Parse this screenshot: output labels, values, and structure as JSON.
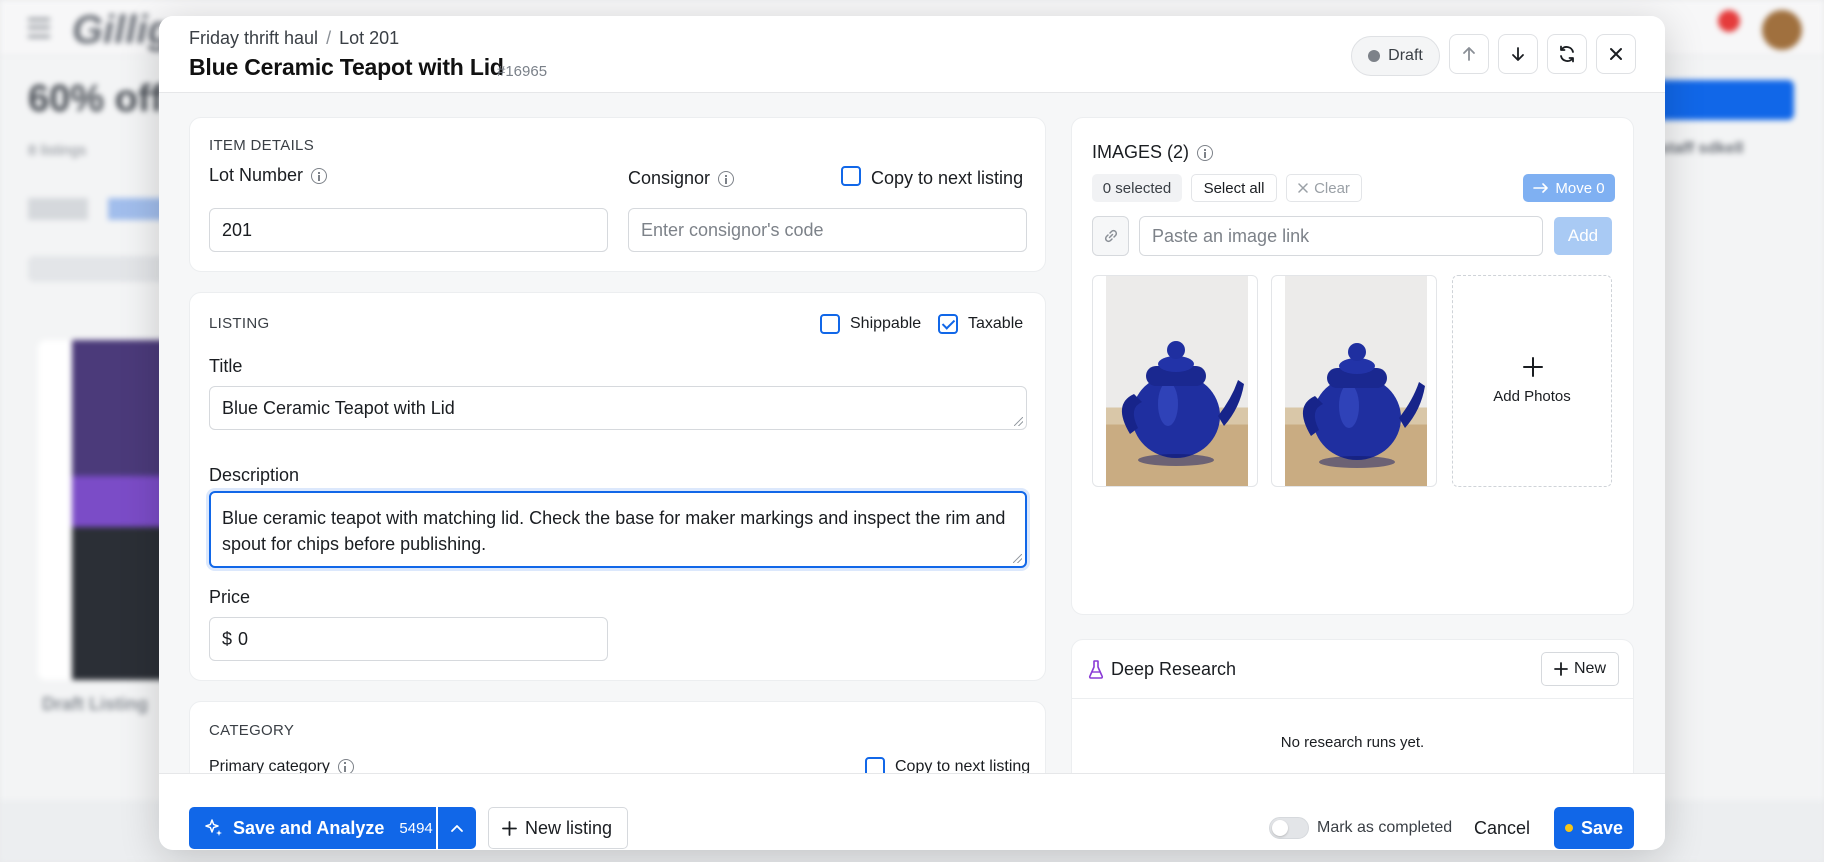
{
  "background": {
    "logo": "Gillig",
    "heading": "60% off",
    "subheading": "8 listings",
    "card_label": "Draft Listing",
    "right_user": "staff sdkell"
  },
  "modal": {
    "breadcrumb": {
      "parent": "Friday thrift haul",
      "separator": "/",
      "current": "Lot 201"
    },
    "title": "Blue Ceramic Teapot with Lid",
    "listing_id": "#16965",
    "status": "Draft",
    "colors": {
      "accent": "#1167e8",
      "status_dot": "#7d8289",
      "save_dot": "#f5c518"
    }
  },
  "item_details": {
    "section_label": "ITEM DETAILS",
    "lot_number_label": "Lot Number",
    "lot_number_value": "201",
    "consignor_label": "Consignor",
    "consignor_placeholder": "Enter consignor's code",
    "copy_label": "Copy to next listing",
    "copy_checked": false
  },
  "listing": {
    "section_label": "LISTING",
    "shippable_label": "Shippable",
    "shippable_checked": false,
    "taxable_label": "Taxable",
    "taxable_checked": true,
    "title_label": "Title",
    "title_value": "Blue Ceramic Teapot with Lid",
    "description_label": "Description",
    "description_value": "Blue ceramic teapot with matching lid. Check the base for maker markings and inspect the rim and spout for chips before publishing.",
    "price_label": "Price",
    "price_currency": "$",
    "price_value": "0"
  },
  "category": {
    "section_label": "CATEGORY",
    "primary_label": "Primary category",
    "copy_label": "Copy to next listing",
    "copy_checked": false
  },
  "images": {
    "title": "IMAGES (2)",
    "selected_label": "0 selected",
    "select_all_label": "Select all",
    "clear_label": "Clear",
    "move_label": "Move 0",
    "link_placeholder": "Paste an image link",
    "add_label": "Add",
    "add_photos_label": "Add Photos",
    "photos": [
      "blue-teapot-photo",
      "blue-teapot-photo"
    ]
  },
  "research": {
    "title": "Deep Research",
    "new_label": "New",
    "empty_text": "No research runs yet."
  },
  "footer": {
    "save_analyze_label": "Save and Analyze",
    "save_analyze_count": "5494",
    "new_listing_label": "New listing",
    "mark_completed_label": "Mark as completed",
    "mark_completed_on": false,
    "cancel_label": "Cancel",
    "save_label": "Save"
  }
}
